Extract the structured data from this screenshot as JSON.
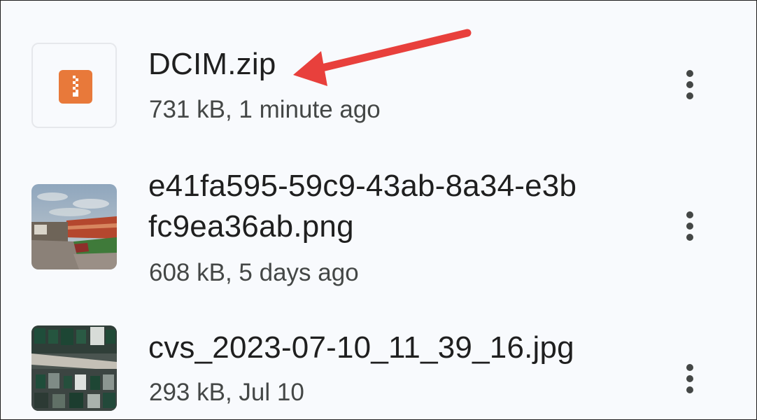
{
  "files": [
    {
      "name": "DCIM.zip",
      "meta": "731 kB, 1 minute ago",
      "icon": "zip-file-icon"
    },
    {
      "name_line1": "e41fa595-59c9-43ab-8a34-e3b",
      "name_line2": "fc9ea36ab.png",
      "meta": "608 kB, 5 days ago",
      "icon": "stadium-photo-thumbnail"
    },
    {
      "name": "cvs_2023-07-10_11_39_16.jpg",
      "meta": "293 kB, Jul 10",
      "icon": "store-photo-thumbnail"
    }
  ],
  "colors": {
    "background": "#f8fafd",
    "zip_accent": "#e8793a",
    "annotation_arrow": "#e8403c",
    "primary_text": "#1f1f1f",
    "secondary_text": "#444746"
  }
}
